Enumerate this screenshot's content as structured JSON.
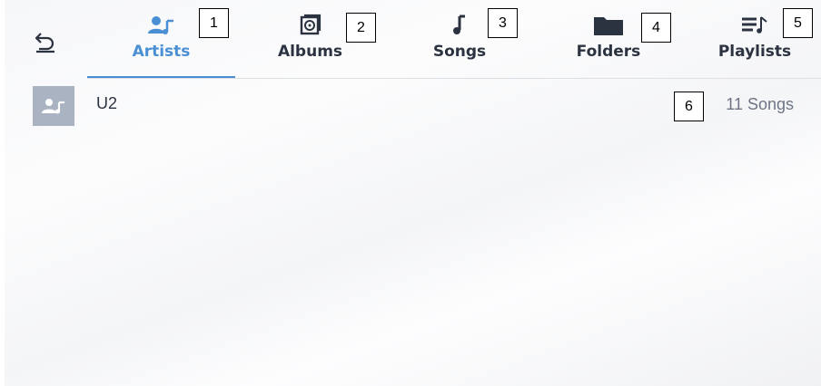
{
  "nav": {
    "back_icon": "back-arrow-icon",
    "tabs": [
      {
        "label": "Artists",
        "icon": "artist-icon",
        "badge": "1",
        "active": true
      },
      {
        "label": "Albums",
        "icon": "album-icon",
        "badge": "2"
      },
      {
        "label": "Songs",
        "icon": "music-note-icon",
        "badge": "3"
      },
      {
        "label": "Folders",
        "icon": "folder-icon",
        "badge": "4"
      },
      {
        "label": "Playlists",
        "icon": "playlist-icon",
        "badge": "5"
      }
    ],
    "active_color": "#4a8fd4"
  },
  "list": {
    "items": [
      {
        "name": "U2",
        "count": "11 Songs",
        "badge": "6",
        "icon": "artist-icon"
      }
    ]
  }
}
